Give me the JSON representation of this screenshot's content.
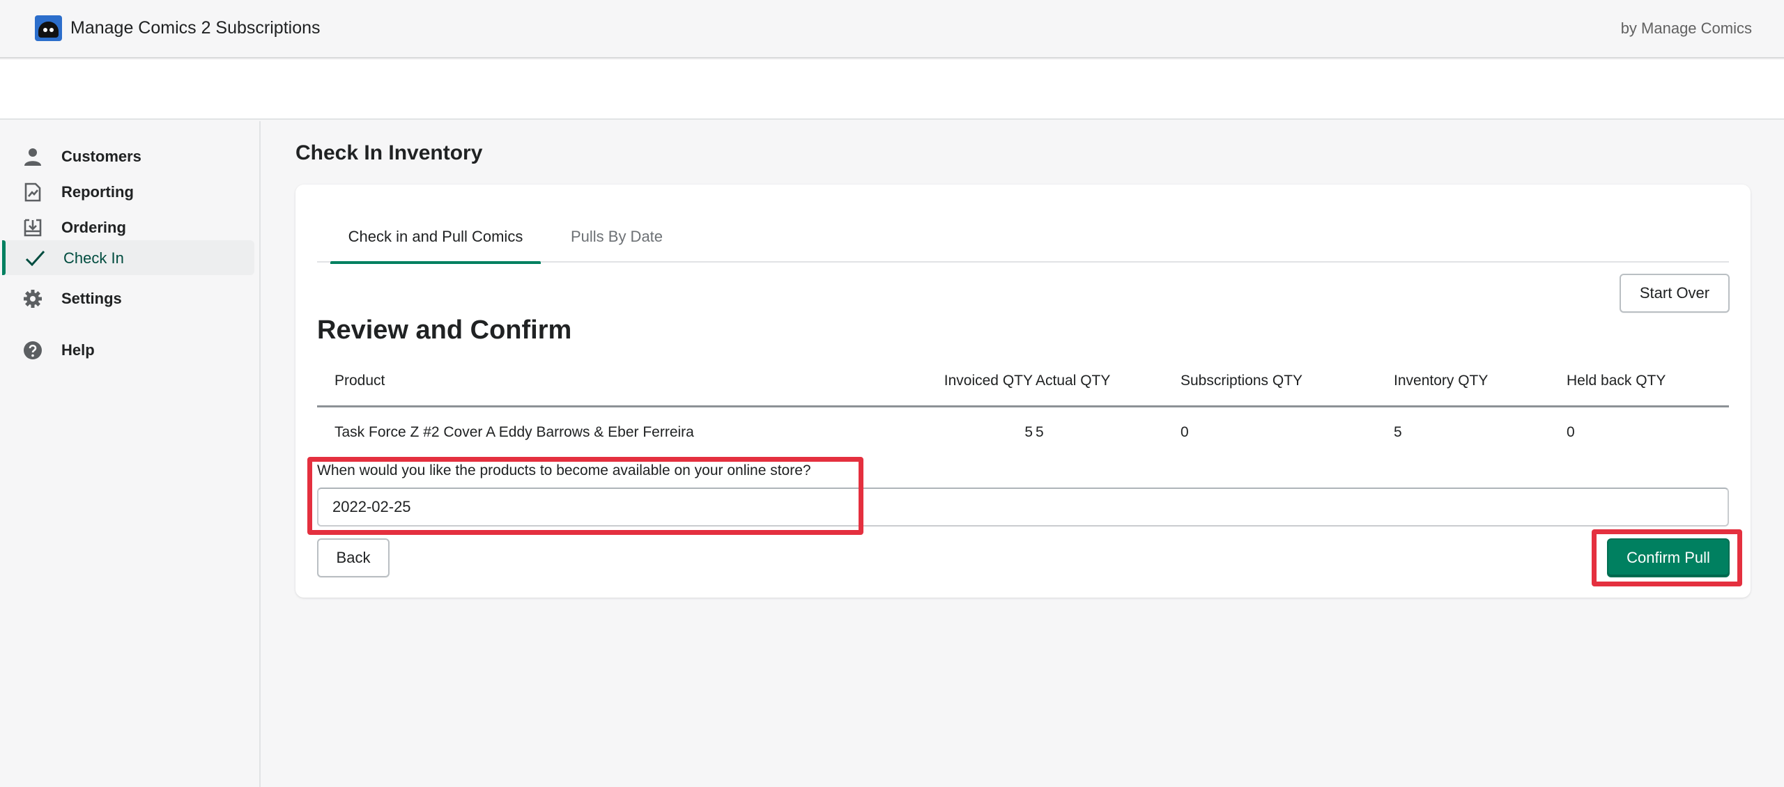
{
  "app": {
    "title": "Manage Comics 2 Subscriptions",
    "by_line": "by Manage Comics"
  },
  "sidebar": {
    "items": [
      {
        "label": "Customers",
        "icon": "person-icon"
      },
      {
        "label": "Reporting",
        "icon": "reporting-icon"
      },
      {
        "label": "Ordering",
        "icon": "download-icon"
      },
      {
        "label": "Check In",
        "icon": "checkmark-icon",
        "active": true
      },
      {
        "label": "Settings",
        "icon": "gear-icon"
      },
      {
        "label": "Help",
        "icon": "help-icon"
      }
    ]
  },
  "page": {
    "title": "Check In Inventory"
  },
  "tabs": [
    {
      "label": "Check in and Pull Comics",
      "selected": true
    },
    {
      "label": "Pulls By Date",
      "selected": false
    }
  ],
  "review": {
    "start_over_label": "Start Over",
    "title": "Review and Confirm",
    "columns": [
      "Product",
      "Invoiced QTY",
      "Actual QTY",
      "Subscriptions QTY",
      "Inventory QTY",
      "Held back QTY"
    ],
    "rows": [
      {
        "product": "Task Force Z #2 Cover A Eddy Barrows & Eber Ferreira",
        "invoiced_qty": "5",
        "actual_qty": "5",
        "subscriptions_qty": "0",
        "inventory_qty": "5",
        "held_back_qty": "0"
      }
    ],
    "availability_label": "When would you like the products to become available on your online store?",
    "availability_date": "2022-02-25",
    "back_label": "Back",
    "confirm_label": "Confirm Pull"
  },
  "colors": {
    "primary": "#008060",
    "annotation": "#e4303f",
    "background": "#f6f6f7"
  }
}
